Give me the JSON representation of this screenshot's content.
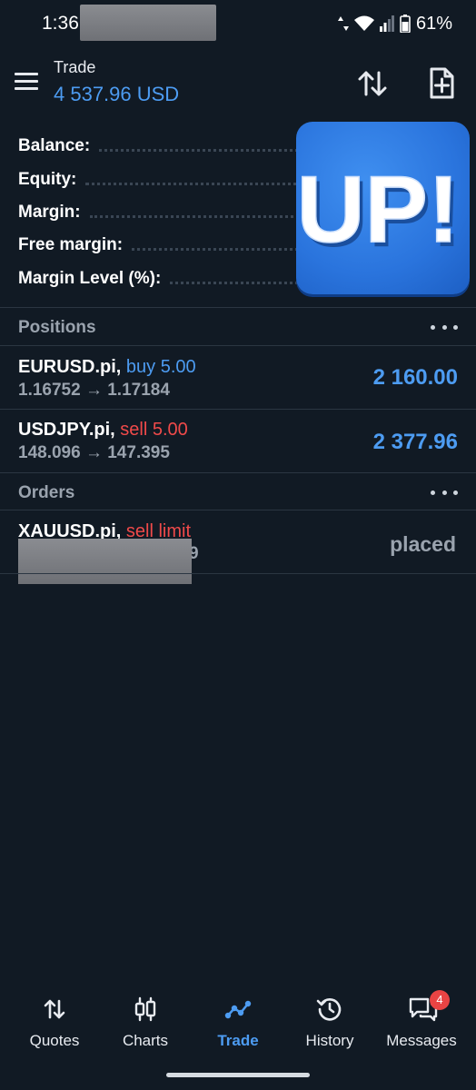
{
  "status_bar": {
    "time": "1:36",
    "battery": "61%"
  },
  "header": {
    "title": "Trade",
    "balance": "4 537.96 USD"
  },
  "account_summary": [
    {
      "label": "Balance:"
    },
    {
      "label": "Equity:"
    },
    {
      "label": "Margin:"
    },
    {
      "label": "Free margin:"
    },
    {
      "label": "Margin Level (%):"
    }
  ],
  "sticker": {
    "text": "UP!"
  },
  "positions": {
    "title": "Positions",
    "items": [
      {
        "symbol": "EURUSD.pi,",
        "side": "buy 5.00",
        "prices": "1.16752 → 1.17184",
        "profit": "2 160.00"
      },
      {
        "symbol": "USDJPY.pi,",
        "side": "sell 5.00",
        "prices": "148.096 → 147.395",
        "profit": "2 377.96"
      }
    ]
  },
  "orders": {
    "title": "Orders",
    "items": [
      {
        "symbol": "XAUUSD.pi,",
        "side": "sell limit",
        "visible_suffix": "9",
        "status": "placed"
      }
    ]
  },
  "bottom_nav": {
    "items": [
      {
        "label": "Quotes",
        "icon": "quotes-icon"
      },
      {
        "label": "Charts",
        "icon": "charts-icon"
      },
      {
        "label": "Trade",
        "icon": "trade-icon",
        "active": true
      },
      {
        "label": "History",
        "icon": "history-icon"
      },
      {
        "label": "Messages",
        "icon": "messages-icon",
        "badge": "4"
      }
    ]
  },
  "colors": {
    "background": "#111a24",
    "accent": "#4d9cf2",
    "sell": "#f04a4a",
    "muted": "#9aa3ae"
  }
}
